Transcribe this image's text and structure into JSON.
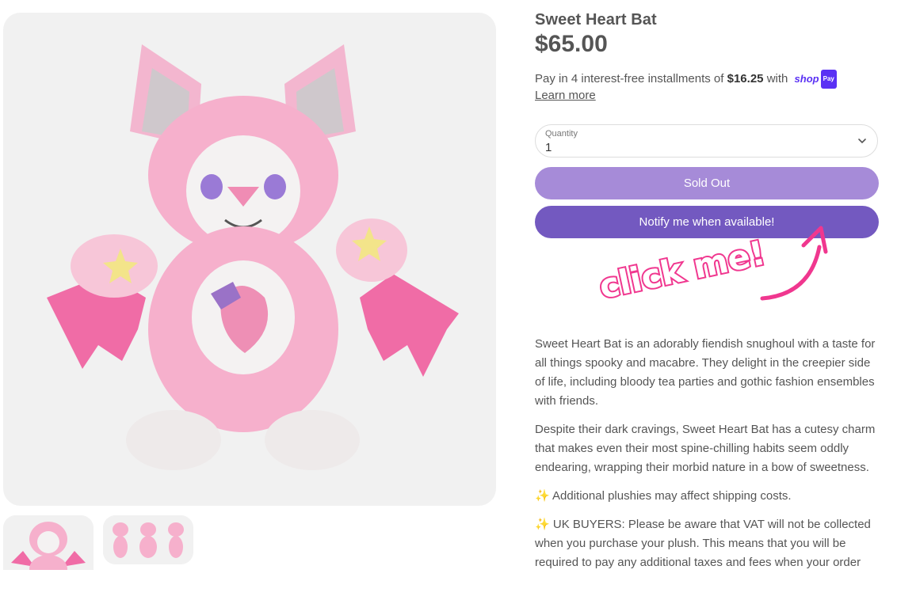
{
  "product": {
    "title": "Sweet Heart Bat",
    "price": "$65.00"
  },
  "installments": {
    "prefix": "Pay in 4 interest-free installments of",
    "amount": "$16.25",
    "suffix": "with",
    "shop_word": "shop",
    "pay_badge": "Pay",
    "learn_more": "Learn more"
  },
  "quantity": {
    "label": "Quantity",
    "value": "1"
  },
  "buttons": {
    "sold_out": "Sold Out",
    "notify": "Notify me when available!"
  },
  "annotation": {
    "text": "click me!",
    "color": "#f0378f"
  },
  "description": {
    "paragraph_1": "Sweet Heart Bat is an adorably fiendish snughoul with a taste for all things spooky and macabre. They delight in the creepier side of life, including bloody tea parties and gothic fashion ensembles with friends.",
    "paragraph_2": "Despite their dark cravings, Sweet Heart Bat has a cutesy charm that makes even their most spine-chilling habits seem oddly endearing, wrapping their morbid nature in a bow of sweetness.",
    "note_1": "Additional plushies may affect shipping costs.",
    "note_2": "UK BUYERS: Please be aware that VAT will not be collected when you purchase your plush. This means that you will be required to pay any additional taxes and fees when your order",
    "sparkle_icon": "sparkles-icon"
  },
  "colors": {
    "sold_out_button": "#a68bd8",
    "notify_button": "#7359c0",
    "shop_pay_brand": "#5a31f4"
  }
}
